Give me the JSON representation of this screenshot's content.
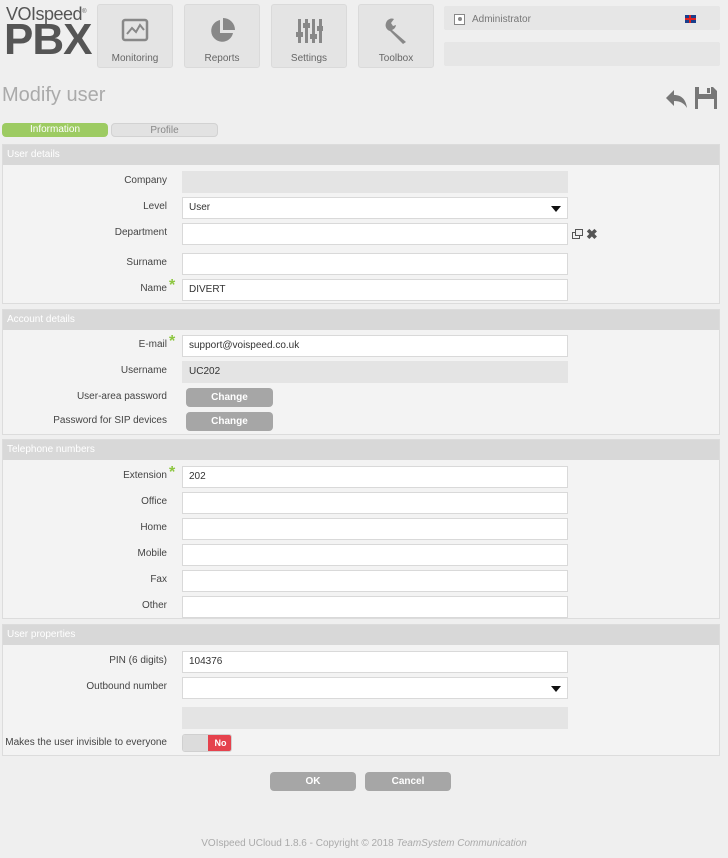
{
  "brand": {
    "top": "VOIspeed",
    "mark": "®",
    "big": "PBX"
  },
  "nav": [
    {
      "label": "Monitoring",
      "icon": "monitor-chart-icon"
    },
    {
      "label": "Reports",
      "icon": "pie-chart-icon"
    },
    {
      "label": "Settings",
      "icon": "sliders-icon"
    },
    {
      "label": "Toolbox",
      "icon": "wrench-icon"
    }
  ],
  "user": {
    "name": "Administrator",
    "language_icon": "uk-flag-icon"
  },
  "page": {
    "title": "Modify user"
  },
  "tabs": {
    "information": "Information",
    "profile": "Profile"
  },
  "user_details": {
    "header": "User details",
    "company": {
      "label": "Company",
      "value": ""
    },
    "level": {
      "label": "Level",
      "value": "User"
    },
    "department": {
      "label": "Department",
      "value": ""
    },
    "surname": {
      "label": "Surname",
      "value": ""
    },
    "name": {
      "label": "Name",
      "value": "DIVERT"
    }
  },
  "account_details": {
    "header": "Account details",
    "email": {
      "label": "E-mail",
      "value": "support@voispeed.co.uk"
    },
    "username": {
      "label": "Username",
      "value": "UC202"
    },
    "user_area_password": {
      "label": "User-area password",
      "button": "Change"
    },
    "sip_password": {
      "label": "Password for SIP devices",
      "button": "Change"
    }
  },
  "telephone_numbers": {
    "header": "Telephone numbers",
    "extension": {
      "label": "Extension",
      "value": "202"
    },
    "office": {
      "label": "Office",
      "value": ""
    },
    "home": {
      "label": "Home",
      "value": ""
    },
    "mobile": {
      "label": "Mobile",
      "value": ""
    },
    "fax": {
      "label": "Fax",
      "value": ""
    },
    "other": {
      "label": "Other",
      "value": ""
    }
  },
  "user_properties": {
    "header": "User properties",
    "pin": {
      "label": "PIN (6 digits)",
      "value": "104376"
    },
    "outbound": {
      "label": "Outbound number",
      "value": ""
    },
    "invisible": {
      "label": "Makes the user invisible to everyone",
      "state": "No"
    }
  },
  "actions": {
    "ok": "OK",
    "cancel": "Cancel"
  },
  "footer": {
    "text": "VOIspeed UCloud 1.8.6 - Copyright © 2018 ",
    "company": "TeamSystem Communication"
  },
  "colors": {
    "accent_green": "#9dcb62",
    "required_star": "#8cc63f",
    "toggle_no": "#e5424d",
    "button_gray": "#a6a6a6"
  }
}
